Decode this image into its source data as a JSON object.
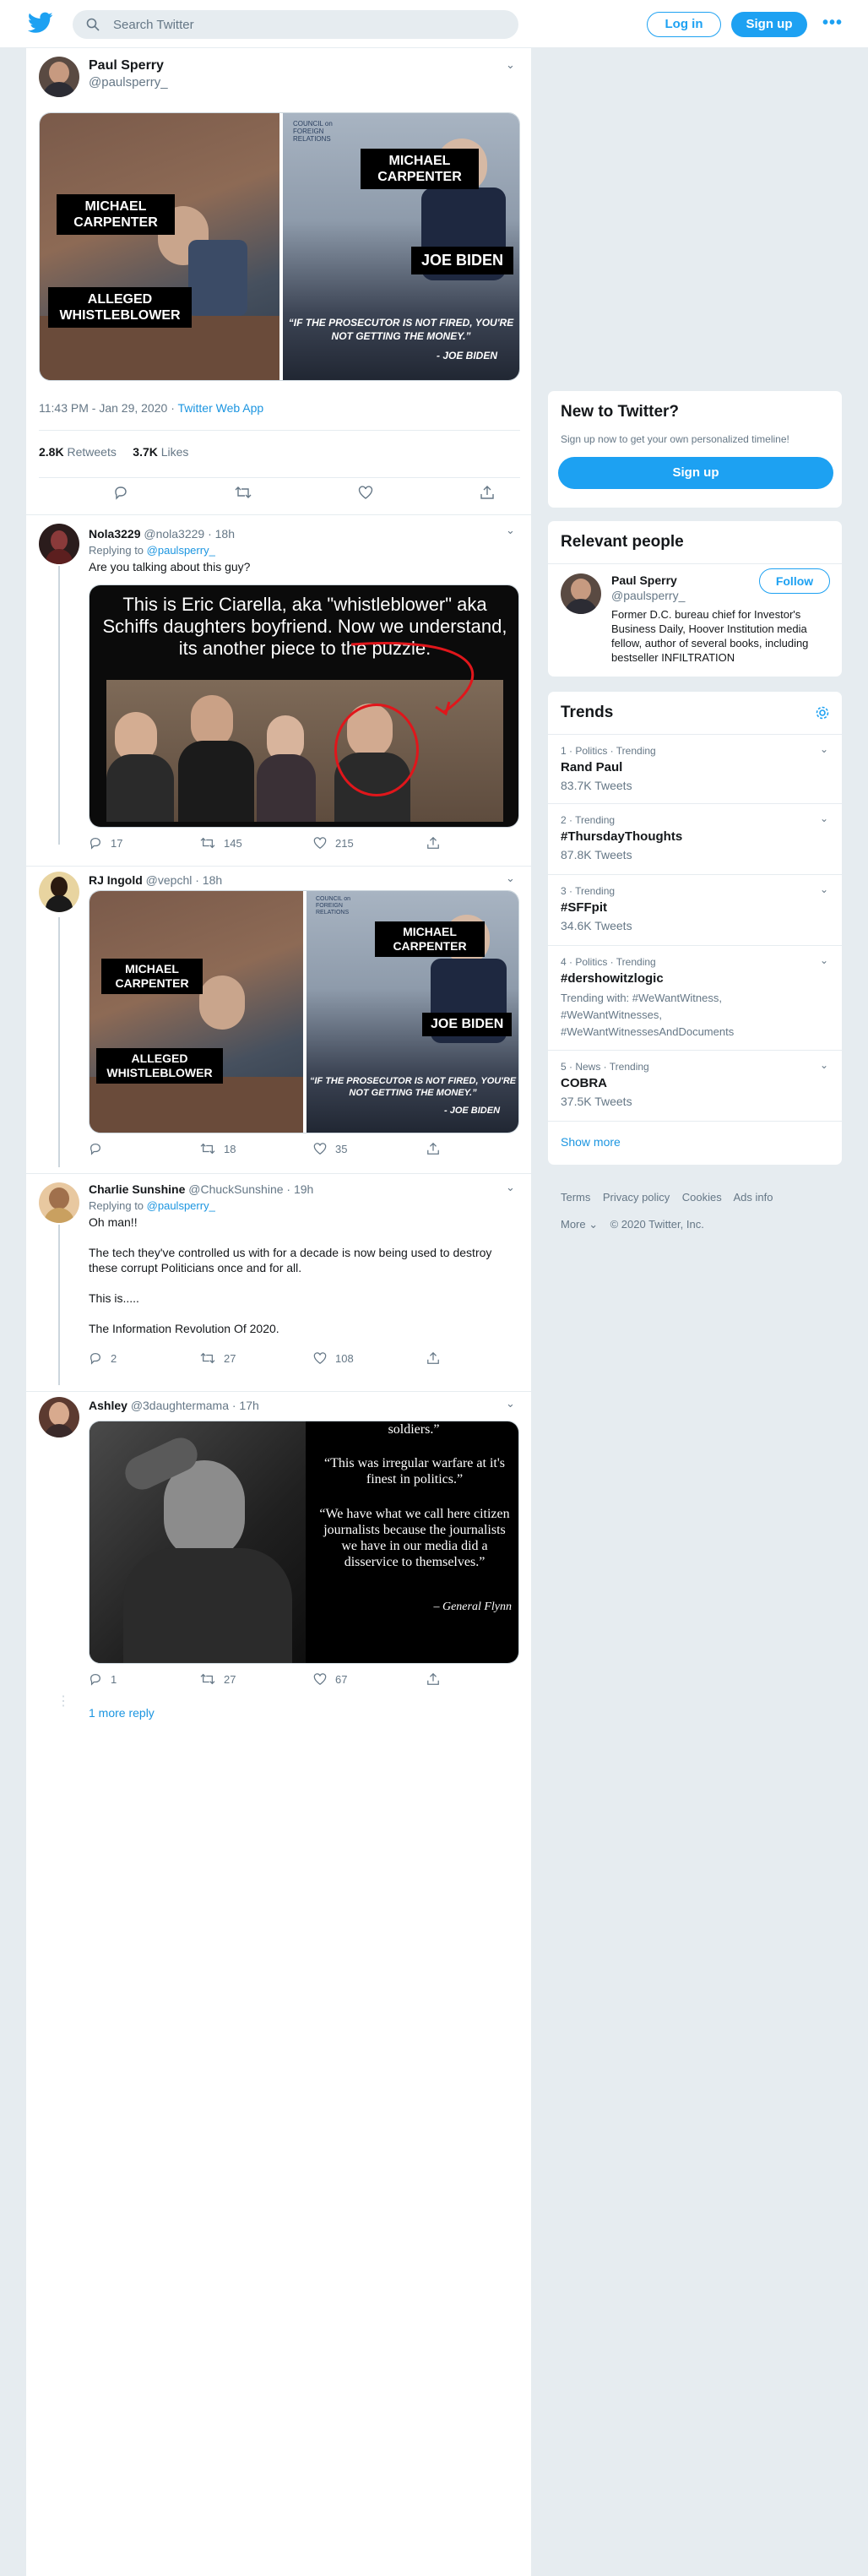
{
  "header": {
    "search_placeholder": "Search Twitter",
    "login_label": "Log in",
    "signup_label": "Sign up",
    "more_label": "•••"
  },
  "tweet": {
    "author_name": "Paul Sperry",
    "author_handle": "@paulsperry_",
    "image_texts": {
      "left_label1": "MICHAEL CARPENTER",
      "left_label2": "ALLEGED WHISTLEBLOWER",
      "right_header": "COUNCIL on FOREIGN RELATIONS",
      "right_label1": "MICHAEL CARPENTER",
      "right_label2": "JOE BIDEN",
      "quote": "“IF THE PROSECUTOR IS NOT FIRED, YOU'RE NOT GETTING THE MONEY.”",
      "quote_attr": "- JOE BIDEN"
    },
    "time": "11:43 PM - Jan 29, 2020",
    "source": "Twitter Web App",
    "retweets_count": "2.8K",
    "retweets_label": "Retweets",
    "likes_count": "3.7K",
    "likes_label": "Likes"
  },
  "replies": [
    {
      "name": "Nola3229",
      "handle": "@nola3229 · 18h",
      "replying_prefix": "Replying to",
      "replying_to": "@paulsperry_",
      "text": "Are you talking about this guy?",
      "image_caption": "This is Eric Ciarella, aka \"whistleblower\" aka Schiffs daughters boyfriend. Now we understand, its another piece to the puzzle.",
      "reply_count": "17",
      "retweet_count": "145",
      "like_count": "215"
    },
    {
      "name": "RJ Ingold",
      "handle": "@vepchl · 18h",
      "reply_count": "",
      "retweet_count": "18",
      "like_count": "35"
    },
    {
      "name": "Charlie Sunshine",
      "handle": "@ChuckSunshine · 19h",
      "replying_prefix": "Replying to",
      "replying_to": "@paulsperry_",
      "text_lines": [
        "Oh man!!",
        "The tech they've controlled us with for a decade is now being used to destroy these corrupt Politicians once and for all.",
        "This is.....",
        "The Information Revolution Of 2020."
      ],
      "reply_count": "2",
      "retweet_count": "27",
      "like_count": "108"
    },
    {
      "name": "Ashley",
      "handle": "@3daughtermama · 17h",
      "quote_lines": [
        "soldiers.”",
        "“This was irregular warfare at it's finest in politics.”",
        "“We have what we call here citizen journalists because the journalists we have in our media did a disservice to themselves.”",
        "– General Flynn"
      ],
      "reply_count": "1",
      "retweet_count": "27",
      "like_count": "67",
      "more_replies": "1 more reply"
    }
  ],
  "sidebar": {
    "new_title": "New to Twitter?",
    "new_sub": "Sign up now to get your own personalized timeline!",
    "new_signup": "Sign up",
    "relevant_title": "Relevant people",
    "person_name": "Paul Sperry",
    "person_handle": "@paulsperry_",
    "person_bio": "Former D.C. bureau chief for Investor's Business Daily, Hoover Institution media fellow, author of several books, including bestseller INFILTRATION",
    "follow_label": "Follow",
    "trends_title": "Trends",
    "trends": [
      {
        "meta": "1 · Politics · Trending",
        "name": "Rand Paul",
        "count": "83.7K Tweets"
      },
      {
        "meta": "2 · Trending",
        "name": "#ThursdayThoughts",
        "count": "87.8K Tweets"
      },
      {
        "meta": "3 · Trending",
        "name": "#SFFpit",
        "count": "34.6K Tweets"
      },
      {
        "meta": "4 · Politics · Trending",
        "name": "#dershowitzlogic",
        "count": "Trending with: #WeWantWitness, #WeWantWitnesses, #WeWantWitnessesAndDocuments"
      },
      {
        "meta": "5 · News · Trending",
        "name": "COBRA",
        "count": "37.5K Tweets"
      }
    ],
    "show_more": "Show more",
    "footer_links": [
      "Terms",
      "Privacy policy",
      "Cookies",
      "Ads info"
    ],
    "footer_more": "More ⌄",
    "copyright": "© 2020 Twitter, Inc."
  },
  "colors": {
    "accent": "#1da1f2",
    "bg": "#e6ecf0",
    "muted": "#657786"
  }
}
